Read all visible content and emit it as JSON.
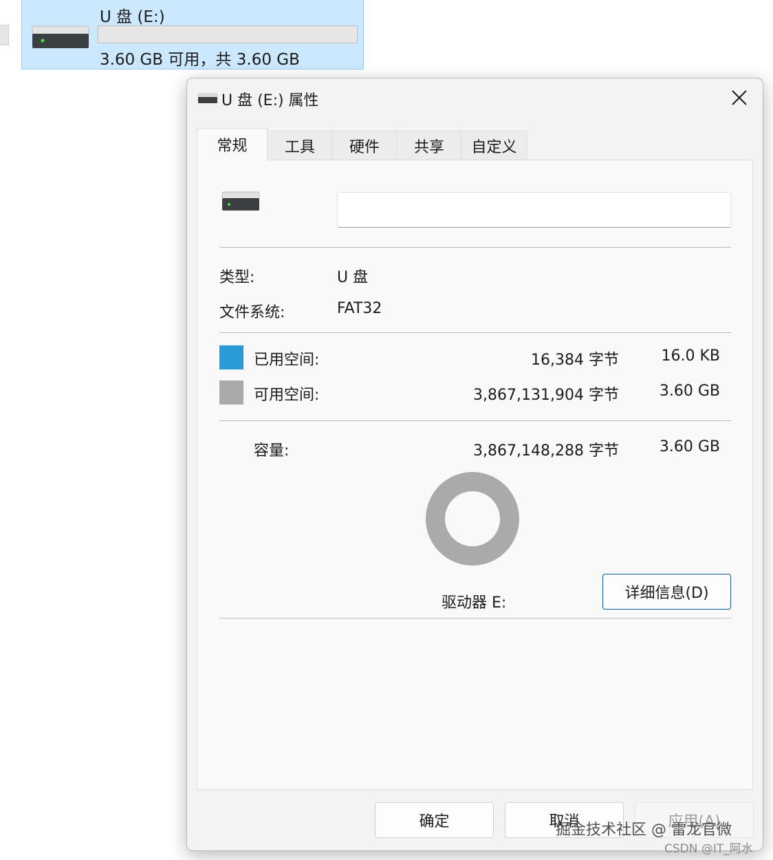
{
  "explorer_tile": {
    "name": "U 盘 (E:)",
    "free_text": "3.60 GB 可用，共 3.60 GB",
    "usage_fraction": 0.0
  },
  "dialog": {
    "title": "U 盘 (E:) 属性",
    "tabs": [
      {
        "label": "常规",
        "active": true
      },
      {
        "label": "工具",
        "active": false
      },
      {
        "label": "硬件",
        "active": false
      },
      {
        "label": "共享",
        "active": false
      },
      {
        "label": "自定义",
        "active": false
      }
    ],
    "general": {
      "volume_label_value": "",
      "type_label": "类型:",
      "type_value": "U 盘",
      "fs_label": "文件系统:",
      "fs_value": "FAT32",
      "used": {
        "label": "已用空间:",
        "bytes": "16,384 字节",
        "size": "16.0 KB",
        "color": "#2a9bd9"
      },
      "free": {
        "label": "可用空间:",
        "bytes": "3,867,131,904 字节",
        "size": "3.60 GB",
        "color": "#aaaaaa"
      },
      "capacity": {
        "label": "容量:",
        "bytes": "3,867,148,288 字节",
        "size": "3.60 GB"
      },
      "drive_label": "驱动器 E:",
      "details_button": "详细信息(D)",
      "used_fraction": 4.2e-06
    },
    "footer": {
      "ok": "确定",
      "cancel": "取消",
      "apply": "应用(A)"
    }
  },
  "watermark": {
    "line1": "掘金技术社区 @ 雷龙官微",
    "line2": "CSDN @IT_阿水"
  },
  "icons": [
    "drive-icon",
    "close-icon",
    "led-icon"
  ]
}
